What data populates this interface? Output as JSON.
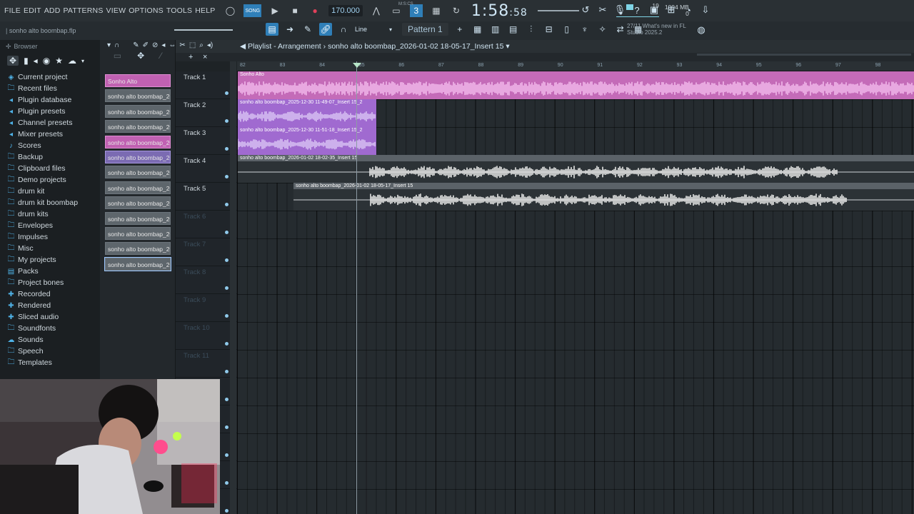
{
  "menu": [
    "FILE",
    "EDIT",
    "ADD",
    "PATTERNS",
    "VIEW",
    "OPTIONS",
    "TOOLS",
    "HELP"
  ],
  "transport": {
    "tempo": "170.000",
    "time_main": "1:58",
    "time_sub": ":58",
    "time_label": "M:S:CS",
    "cpu": "19",
    "memory": "1004 MB",
    "memory_sub": "0"
  },
  "project_file": "sonho alto boombap.flp",
  "snap": "Line",
  "pattern": "Pattern 1",
  "news": {
    "count": "27/11",
    "text1": "What's new in FL",
    "text2": "Studio 2025.2"
  },
  "browser": {
    "title": "Browser",
    "items": [
      {
        "label": "Current project",
        "icon": "project-icon"
      },
      {
        "label": "Recent files",
        "icon": "folder-icon"
      },
      {
        "label": "Plugin database",
        "icon": "plug-icon"
      },
      {
        "label": "Plugin presets",
        "icon": "plug-icon"
      },
      {
        "label": "Channel presets",
        "icon": "plug-icon"
      },
      {
        "label": "Mixer presets",
        "icon": "plug-icon"
      },
      {
        "label": "Scores",
        "icon": "note-icon"
      },
      {
        "label": "Backup",
        "icon": "folder-icon"
      },
      {
        "label": "Clipboard files",
        "icon": "folder-icon"
      },
      {
        "label": "Demo projects",
        "icon": "folder-icon"
      },
      {
        "label": "drum kit",
        "icon": "folder-icon"
      },
      {
        "label": "drum kit boombap",
        "icon": "folder-icon"
      },
      {
        "label": "drum kits",
        "icon": "folder-icon"
      },
      {
        "label": "Envelopes",
        "icon": "folder-icon"
      },
      {
        "label": "Impulses",
        "icon": "folder-icon"
      },
      {
        "label": "Misc",
        "icon": "folder-icon"
      },
      {
        "label": "My projects",
        "icon": "folder-icon"
      },
      {
        "label": "Packs",
        "icon": "packs-icon"
      },
      {
        "label": "Project bones",
        "icon": "folder-icon"
      },
      {
        "label": "Recorded",
        "icon": "plus-icon"
      },
      {
        "label": "Rendered",
        "icon": "plus-icon"
      },
      {
        "label": "Sliced audio",
        "icon": "plus-icon"
      },
      {
        "label": "Soundfonts",
        "icon": "folder-icon"
      },
      {
        "label": "Sounds",
        "icon": "cloud-icon"
      },
      {
        "label": "Speech",
        "icon": "folder-icon"
      },
      {
        "label": "Templates",
        "icon": "folder-icon"
      }
    ]
  },
  "picker": {
    "clips": [
      {
        "label": "Sonho Alto",
        "color": "pink"
      },
      {
        "label": "sonho alto boombap_20...",
        "color": "audio"
      },
      {
        "label": "sonho alto boombap_20...",
        "color": "audio"
      },
      {
        "label": "sonho alto boombap_20...",
        "color": "audio"
      },
      {
        "label": "sonho alto boombap_20...",
        "color": "pink"
      },
      {
        "label": "sonho alto boombap_20...",
        "color": "purple"
      },
      {
        "label": "sonho alto boombap_20...",
        "color": "audio"
      },
      {
        "label": "sonho alto boombap_20...",
        "color": "audio"
      },
      {
        "label": "sonho alto boombap_20...",
        "color": "audio"
      },
      {
        "label": "sonho alto boombap_20...",
        "color": "audio"
      },
      {
        "label": "sonho alto boombap_20...",
        "color": "audio"
      },
      {
        "label": "sonho alto boombap_20...",
        "color": "audio"
      },
      {
        "label": "sonho alto boombap_20...",
        "color": "audio"
      }
    ]
  },
  "playlist": {
    "title": "Playlist - Arrangement",
    "subtitle": "sonho alto boombap_2026-01-02 18-05-17_Insert 15",
    "ruler": [
      "82",
      "83",
      "84",
      "85",
      "86",
      "87",
      "88",
      "89",
      "90",
      "91",
      "92",
      "93",
      "94",
      "95",
      "96",
      "97",
      "98"
    ],
    "tracks": [
      "Track 1",
      "Track 2",
      "Track 3",
      "Track 4",
      "Track 5",
      "Track 6",
      "Track 7",
      "Track 8",
      "Track 9",
      "Track 10",
      "Track 11"
    ],
    "clips": [
      {
        "label": "Sonho Alto",
        "track": 1,
        "color": "#c46bb8",
        "wave": "#f1b7ea"
      },
      {
        "label": "sonho alto boombap_2025-12-30 11-49-07_Insert 15_2",
        "track": 2,
        "color": "#a06ad0",
        "wave": "#d8c2f4"
      },
      {
        "label": "sonho alto boombap_2025-12-30 11-51-18_Insert 15_2",
        "track": 3,
        "color": "#a06ad0",
        "wave": "#d8c2f4"
      },
      {
        "label": "sonho alto boombap_2026-01-02 18-02-35_Insert 15",
        "track": 4,
        "color": "#5b6268",
        "wave": "#e6e6e6"
      },
      {
        "label": "sonho alto boombap_2026-01-02 18-05-17_Insert 15",
        "track": 5,
        "color": "#5b6268",
        "wave": "#e6e6e6"
      }
    ]
  }
}
